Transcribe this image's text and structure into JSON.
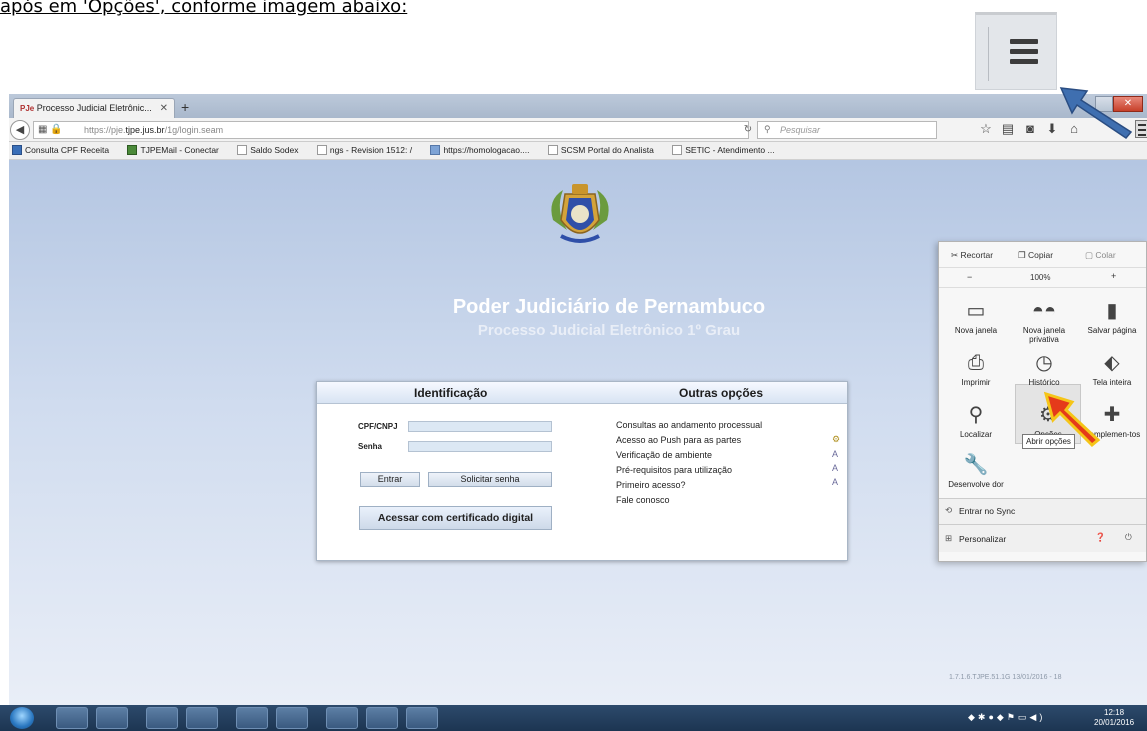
{
  "caption": "após em 'Opções', conforme imagem abaixo:",
  "browser": {
    "tab_title": "Processo Judicial Eletrônic...",
    "tab_badge": "PJe",
    "url_prefix": "https://pje.",
    "url_domain": "tjpe.jus.br",
    "url_path": "/1g/login.seam",
    "search_placeholder": "Pesquisar"
  },
  "bookmarks": [
    "Consulta CPF Receita",
    "TJPEMail - Conectar",
    "Saldo Sodex",
    "ngs - Revision 1512: /",
    "https://homologacao....",
    "SCSM Portal do Analista",
    "SETIC - Atendimento ..."
  ],
  "page": {
    "title": "Poder Judiciário de Pernambuco",
    "subtitle": "Processo Judicial Eletrônico 1º Grau",
    "login": {
      "heading": "Identificação",
      "cpf_label": "CPF/CNPJ",
      "password_label": "Senha",
      "enter_button": "Entrar",
      "request_password_button": "Solicitar senha",
      "certificate_button": "Acessar com certificado digital"
    },
    "other": {
      "heading": "Outras opções",
      "links": [
        "Consultas ao andamento processual",
        "Acesso ao Push para as partes",
        "Verificação de ambiente",
        "Pré-requisitos para utilização",
        "Primeiro acesso?",
        "Fale conosco"
      ]
    },
    "version": "1.7.1.6.TJPE.51.1G 13/01/2016 - 18"
  },
  "menu": {
    "cut": "Recortar",
    "copy": "Copiar",
    "paste": "Colar",
    "zoom_out": "−",
    "zoom_level": "100%",
    "zoom_in": "+",
    "items": [
      {
        "label": "Nova janela",
        "icon": "new-window-icon"
      },
      {
        "label": "Nova janela privativa",
        "icon": "mask-icon"
      },
      {
        "label": "Salvar página",
        "icon": "page-icon"
      },
      {
        "label": "Imprimir",
        "icon": "printer-icon"
      },
      {
        "label": "Histórico",
        "icon": "clock-icon"
      },
      {
        "label": "Tela inteira",
        "icon": "fullscreen-icon"
      },
      {
        "label": "Localizar",
        "icon": "search-icon"
      },
      {
        "label": "Opções",
        "icon": "gear-icon"
      },
      {
        "label": "Complemen-tos",
        "icon": "puzzle-icon"
      },
      {
        "label": "Desenvolve dor",
        "icon": "wrench-icon"
      }
    ],
    "tooltip": "Abrir opções",
    "sync": "Entrar no Sync",
    "customize": "Personalizar"
  },
  "taskbar": {
    "time": "12:18",
    "date": "20/01/2016"
  },
  "colors": {
    "page_bg": "#c6d5ec",
    "arrow_blue": "#3f6fb0",
    "arrow_red": "#e53a1a",
    "arrow_yellow": "#f5c518"
  }
}
